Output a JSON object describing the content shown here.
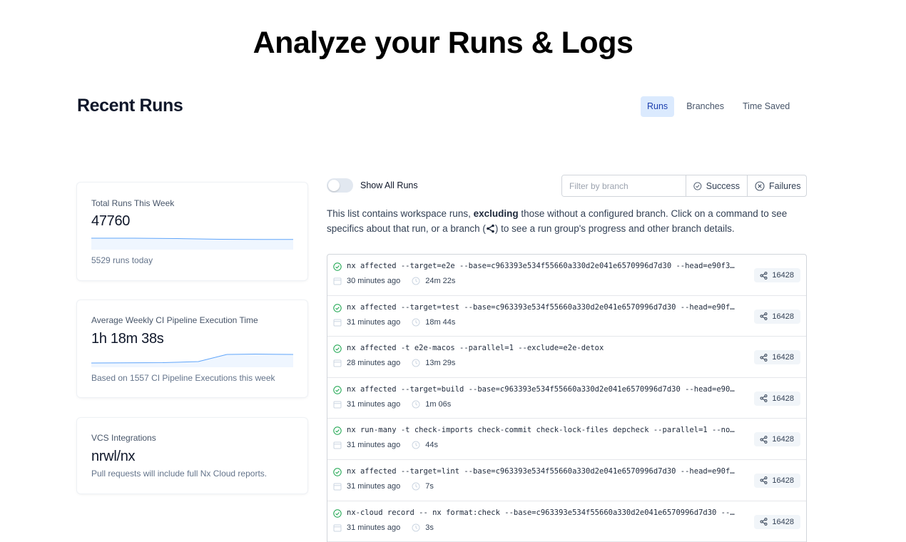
{
  "hero": {
    "title": "Analyze your Runs & Logs"
  },
  "section": {
    "title": "Recent Runs"
  },
  "tabs": [
    {
      "label": "Runs",
      "active": true
    },
    {
      "label": "Branches",
      "active": false
    },
    {
      "label": "Time Saved",
      "active": false
    }
  ],
  "stats": {
    "total_runs": {
      "label": "Total Runs This Week",
      "value": "47760",
      "note": "5529 runs today"
    },
    "avg_time": {
      "label": "Average Weekly CI Pipeline Execution Time",
      "value": "1h 18m 38s",
      "note": "Based on 1557 CI Pipeline Executions this week"
    },
    "vcs": {
      "label": "VCS Integrations",
      "value": "nrwl/nx",
      "note": "Pull requests will include full Nx Cloud reports."
    }
  },
  "filters": {
    "toggle_label": "Show All Runs",
    "toggle_on": false,
    "branch_placeholder": "Filter by branch",
    "success_label": "Success",
    "failures_label": "Failures"
  },
  "description": {
    "part1": "This list contains workspace runs, ",
    "bold": "excluding",
    "part2": " those without a configured branch. Click on a command to see specifics about that run, or a branch (",
    "part3": ") to see a run group's progress and other branch details."
  },
  "colors": {
    "accent": "#1e40af",
    "accent_bg": "#dbeafe",
    "success": "#16a34a"
  },
  "runs": [
    {
      "command": "nx affected --target=e2e --base=c963393e534f55660a330d2e041e6570996d7d30 --head=e90f3a45…",
      "when": "30 minutes ago",
      "duration": "24m 22s",
      "branch": "16428",
      "status": "success"
    },
    {
      "command": "nx affected --target=test --base=c963393e534f55660a330d2e041e6570996d7d30 --head=e90f3a4…",
      "when": "31 minutes ago",
      "duration": "18m 44s",
      "branch": "16428",
      "status": "success"
    },
    {
      "command": "nx affected -t e2e-macos --parallel=1 --exclude=e2e-detox",
      "when": "28 minutes ago",
      "duration": "13m 29s",
      "branch": "16428",
      "status": "success"
    },
    {
      "command": "nx affected --target=build --base=c963393e534f55660a330d2e041e6570996d7d30 --head=e90f3a…",
      "when": "31 minutes ago",
      "duration": "1m 06s",
      "branch": "16428",
      "status": "success"
    },
    {
      "command": "nx run-many -t check-imports check-commit check-lock-files depcheck --parallel=1 --no-dte",
      "when": "31 minutes ago",
      "duration": "44s",
      "branch": "16428",
      "status": "success"
    },
    {
      "command": "nx affected --target=lint --base=c963393e534f55660a330d2e041e6570996d7d30 --head=e90f3a4…",
      "when": "31 minutes ago",
      "duration": "7s",
      "branch": "16428",
      "status": "success"
    },
    {
      "command": "nx-cloud record -- nx format:check --base=c963393e534f55660a330d2e041e6570996d7d30 --hea…",
      "when": "31 minutes ago",
      "duration": "3s",
      "branch": "16428",
      "status": "success"
    }
  ]
}
